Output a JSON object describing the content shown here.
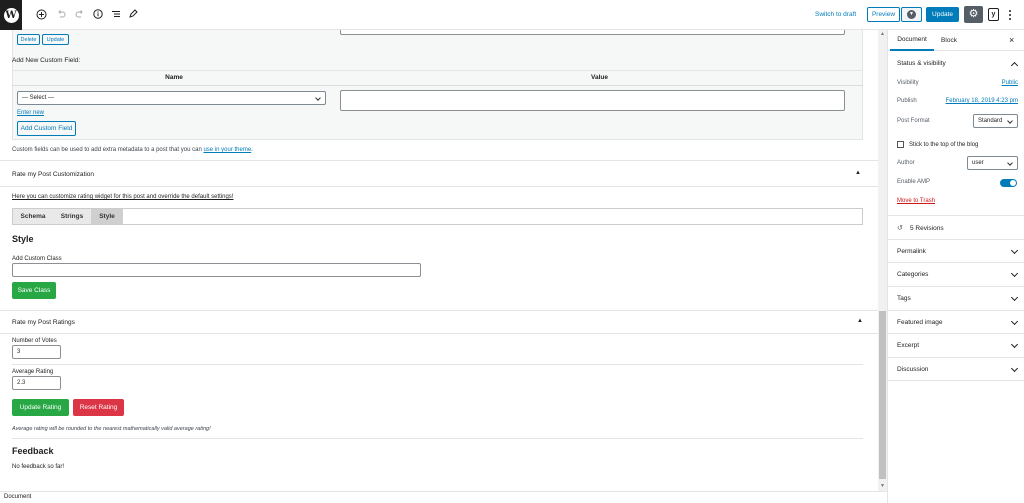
{
  "topbar": {
    "switch_to_draft": "Switch to draft",
    "preview": "Preview",
    "update": "Update"
  },
  "custom_fields": {
    "delete": "Delete",
    "update": "Update",
    "add_new_heading": "Add New Custom Field:",
    "col_name": "Name",
    "col_value": "Value",
    "select_placeholder": "— Select —",
    "enter_new": "Enter new",
    "add_button": "Add Custom Field",
    "help_text": "Custom fields can be used to add extra metadata to a post that you can",
    "help_link": "use in your theme"
  },
  "rmp_custom": {
    "title": "Rate my Post Customization",
    "intro_link": "Here you can customize rating widget for this post and override the default settings!",
    "tabs": [
      "Schema",
      "Strings",
      "Style"
    ],
    "style_heading": "Style",
    "custom_class_label": "Add Custom Class",
    "custom_class_value": "",
    "save_button": "Save Class"
  },
  "rmp_ratings": {
    "title": "Rate my Post Ratings",
    "votes_label": "Number of Votes",
    "votes_value": "3",
    "avg_label": "Average Rating",
    "avg_value": "2.3",
    "update_button": "Update Rating",
    "reset_button": "Reset Rating",
    "note": "Average rating will be rounded to the nearest mathematically valid average rating!",
    "feedback_heading": "Feedback",
    "feedback_text": "No feedback so far!"
  },
  "footer": {
    "breadcrumb": "Document"
  },
  "sidebar": {
    "tab_document": "Document",
    "tab_block": "Block",
    "status_title": "Status & visibility",
    "visibility_label": "Visibility",
    "visibility_value": "Public",
    "publish_label": "Publish",
    "publish_value": "February 18, 2019 4:23 pm",
    "post_format_label": "Post Format",
    "post_format_value": "Standard",
    "sticky_label": "Stick to the top of the blog",
    "author_label": "Author",
    "author_value": "user",
    "amp_label": "Enable AMP",
    "trash": "Move to Trash",
    "revisions": "5 Revisions",
    "panels": [
      "Permalink",
      "Categories",
      "Tags",
      "Featured image",
      "Excerpt",
      "Discussion"
    ]
  },
  "colors": {
    "accent": "#007cba",
    "green": "#28a745",
    "red": "#dc3545",
    "trash": "#cc1818"
  }
}
